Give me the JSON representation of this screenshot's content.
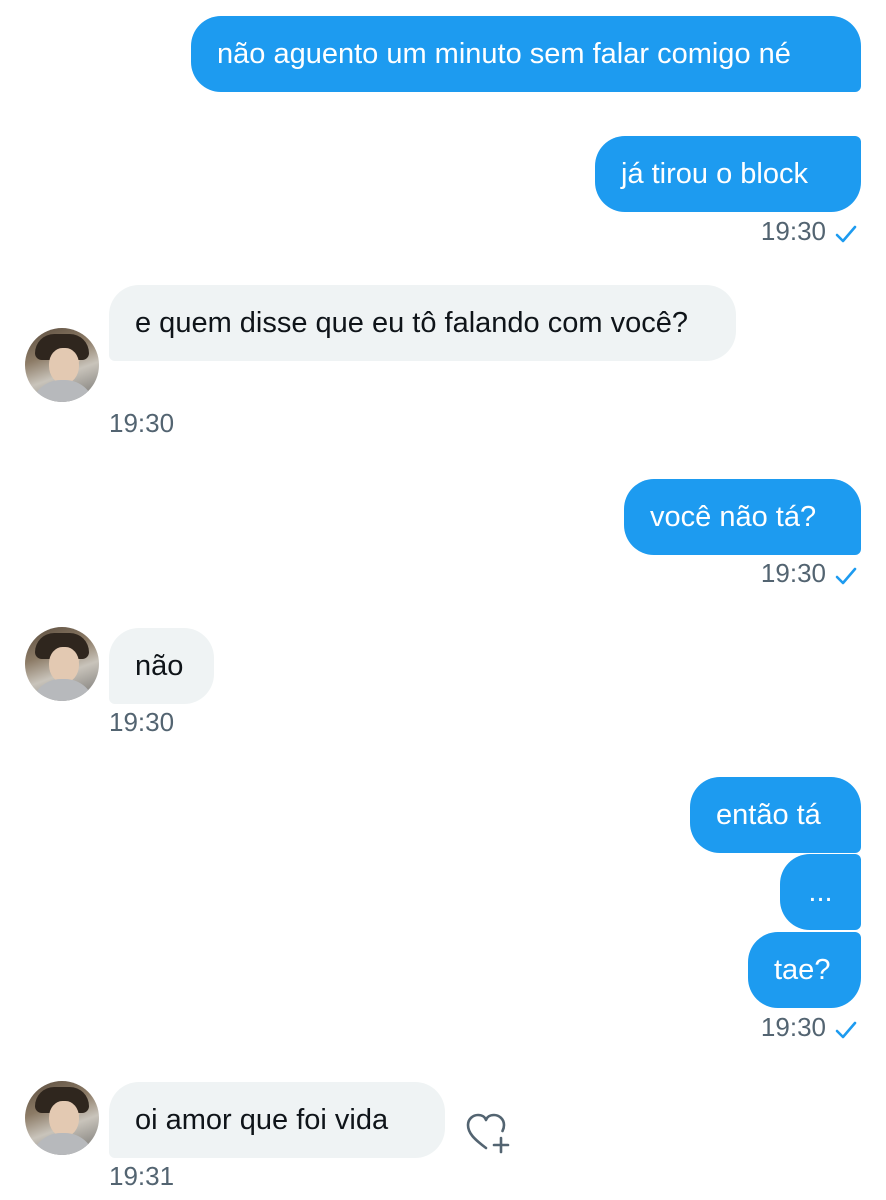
{
  "colors": {
    "outgoing_bubble": "#1d9bf0",
    "incoming_bubble": "#eff3f4",
    "timestamp": "#536471",
    "read_check": "#1d9bf0"
  },
  "icons": {
    "read_receipt": "check-icon",
    "react": "heart-plus-icon",
    "avatar": "profile-photo"
  },
  "messages": [
    {
      "direction": "outgoing",
      "text": "não aguento um minuto sem falar comigo né"
    },
    {
      "direction": "outgoing",
      "text": "já tirou o block",
      "timestamp": "19:30"
    },
    {
      "direction": "incoming",
      "text": "e quem disse que eu tô falando com você?",
      "timestamp": "19:30"
    },
    {
      "direction": "outgoing",
      "text": "você não tá?",
      "timestamp": "19:30"
    },
    {
      "direction": "incoming",
      "text": "não",
      "timestamp": "19:30"
    },
    {
      "direction": "outgoing",
      "text": "então tá"
    },
    {
      "direction": "outgoing",
      "text": "..."
    },
    {
      "direction": "outgoing",
      "text": "tae?",
      "timestamp": "19:30"
    },
    {
      "direction": "incoming",
      "text": "oi amor que foi vida",
      "timestamp": "19:31"
    }
  ]
}
